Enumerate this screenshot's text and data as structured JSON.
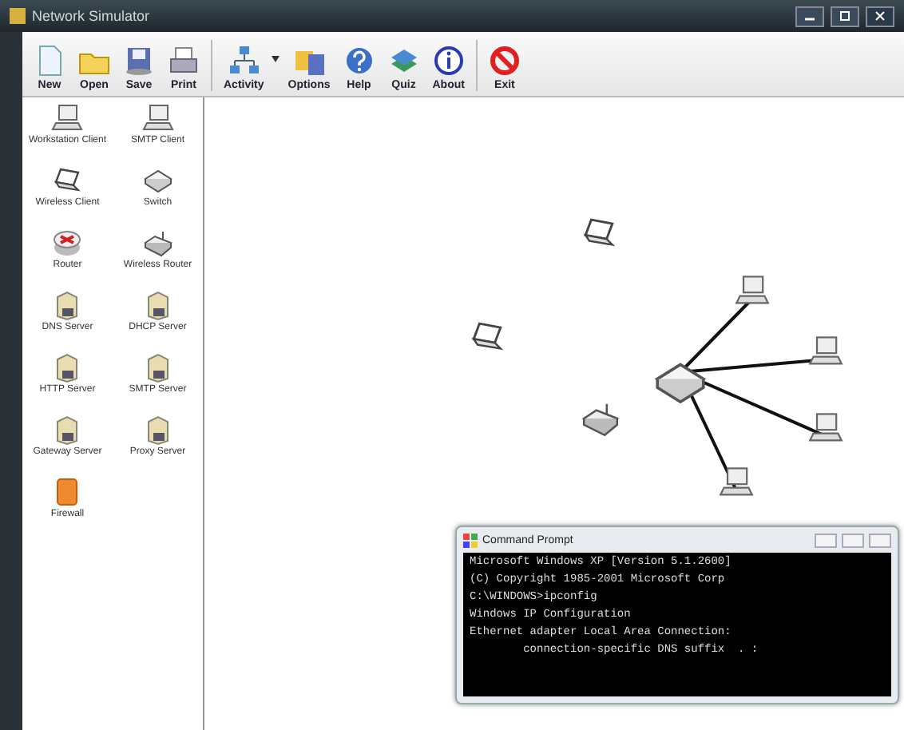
{
  "window": {
    "title": "Network Simulator"
  },
  "toolbar": [
    {
      "label": "New",
      "kind": "new"
    },
    {
      "label": "Open",
      "kind": "open"
    },
    {
      "label": "Save",
      "kind": "save"
    },
    {
      "label": "Print",
      "kind": "print"
    },
    {
      "label": "Activity",
      "kind": "activity"
    },
    {
      "label": "Options",
      "kind": "options"
    },
    {
      "label": "Help",
      "kind": "help"
    },
    {
      "label": "Quiz",
      "kind": "quiz"
    },
    {
      "label": "About",
      "kind": "about"
    },
    {
      "label": "Exit",
      "kind": "exit"
    }
  ],
  "palette": [
    {
      "label": "Workstation Client",
      "kind": "workstation"
    },
    {
      "label": "SMTP Client",
      "kind": "workstation"
    },
    {
      "label": "Wireless Client",
      "kind": "laptop"
    },
    {
      "label": "Switch",
      "kind": "switch"
    },
    {
      "label": "Router",
      "kind": "router"
    },
    {
      "label": "Wireless Router",
      "kind": "wrouter"
    },
    {
      "label": "DNS Server",
      "kind": "server"
    },
    {
      "label": "DHCP Server",
      "kind": "server"
    },
    {
      "label": "HTTP Server",
      "kind": "server"
    },
    {
      "label": "SMTP Server",
      "kind": "server"
    },
    {
      "label": "Gateway Server",
      "kind": "server"
    },
    {
      "label": "Proxy Server",
      "kind": "server"
    },
    {
      "label": "Firewall",
      "kind": "firewall"
    }
  ],
  "canvas": {
    "nodes": [
      {
        "kind": "laptop"
      },
      {
        "kind": "laptop"
      },
      {
        "kind": "switch"
      },
      {
        "kind": "wrouter"
      },
      {
        "kind": "workstation"
      },
      {
        "kind": "workstation"
      },
      {
        "kind": "workstation"
      },
      {
        "kind": "workstation"
      }
    ]
  },
  "command_prompt": {
    "title": "Command Prompt",
    "lines": [
      "Microsoft Windows XP [Version 5.1.2600]",
      "(C) Copyright 1985-2001 Microsoft Corp",
      "C:\\WINDOWS>ipconfig",
      "Windows IP Configuration",
      "Ethernet adapter Local Area Connection:",
      "        connection-specific DNS suffix  . :"
    ]
  }
}
